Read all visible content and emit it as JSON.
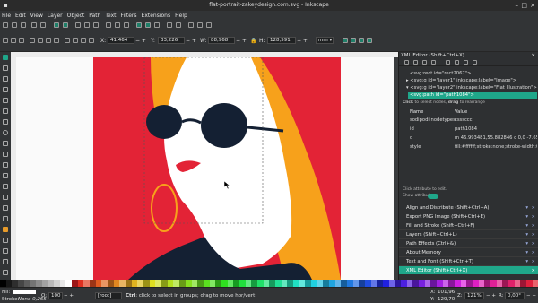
{
  "window": {
    "title": "flat-portrait-zakeydesign.com.svg - Inkscape"
  },
  "menu": [
    "File",
    "Edit",
    "View",
    "Layer",
    "Object",
    "Path",
    "Text",
    "Filters",
    "Extensions",
    "Help"
  ],
  "controls": {
    "x_label": "X:",
    "x_value": "41,464",
    "y_label": "Y:",
    "y_value": "33,226",
    "w_label": "W:",
    "w_value": "88,968",
    "h_label": "H:",
    "h_value": "128,591",
    "unit": "mm"
  },
  "panel": {
    "title": "XML Editor (Shift+Ctrl+X)",
    "nodes": [
      "<svg:rect id=\"rect2067\">",
      "<svg:g id=\"layer1\" inkscape:label=\"Image\">",
      "<svg:g id=\"layer2\" inkscape:label=\"Flat Illustration\">",
      "<svg:path id=\"path1084\">"
    ],
    "hint_bold": "Click",
    "hint_text": " to select nodes, ",
    "hint_bold2": "drag",
    "hint_text2": " to rearrange",
    "col_name": "Name",
    "col_value": "Value",
    "attributes": [
      {
        "name": "sodipodi:nodetypes",
        "value": "csssccc"
      },
      {
        "name": "id",
        "value": "path1084"
      },
      {
        "name": "d",
        "value": "m 46.993481,55.882846 c 0,0 -7.65..."
      },
      {
        "name": "style",
        "value": "fill:#ffffff;stroke:none;stroke-width:0..."
      }
    ],
    "attr_hint": "Click attribute to edit.",
    "show_attributes": "Show attributes",
    "docked": [
      "Align and Distribute (Shift+Ctrl+A)",
      "Export PNG Image (Shift+Ctrl+E)",
      "Fill and Stroke (Shift+Ctrl+F)",
      "Layers (Shift+Ctrl+L)",
      "Path Effects (Ctrl+&)",
      "About Memory",
      "Text and Font (Shift+Ctrl+T)",
      "XML Editor (Shift+Ctrl+X)"
    ]
  },
  "status": {
    "fill_label": "Fill:",
    "stroke_label": "Stroke:",
    "stroke_value": "None 0,265",
    "opacity_label": "O:",
    "opacity_value": "100",
    "layer": "[root]",
    "message_bold": "Ctrl",
    "message": ": click to select in groups; drag to move hor/vert",
    "x_label": "X:",
    "x_value": "101,96",
    "y_label": "Y:",
    "y_value": "129,70",
    "z_label": "Z:",
    "z_value": "121%",
    "r_label": "R:",
    "r_value": "0,00°"
  },
  "colors": {
    "accent": "#1fa78a",
    "art_red": "#e32336",
    "art_orange": "#f7a11b",
    "art_navy": "#142033",
    "art_white": "#ffffff"
  }
}
